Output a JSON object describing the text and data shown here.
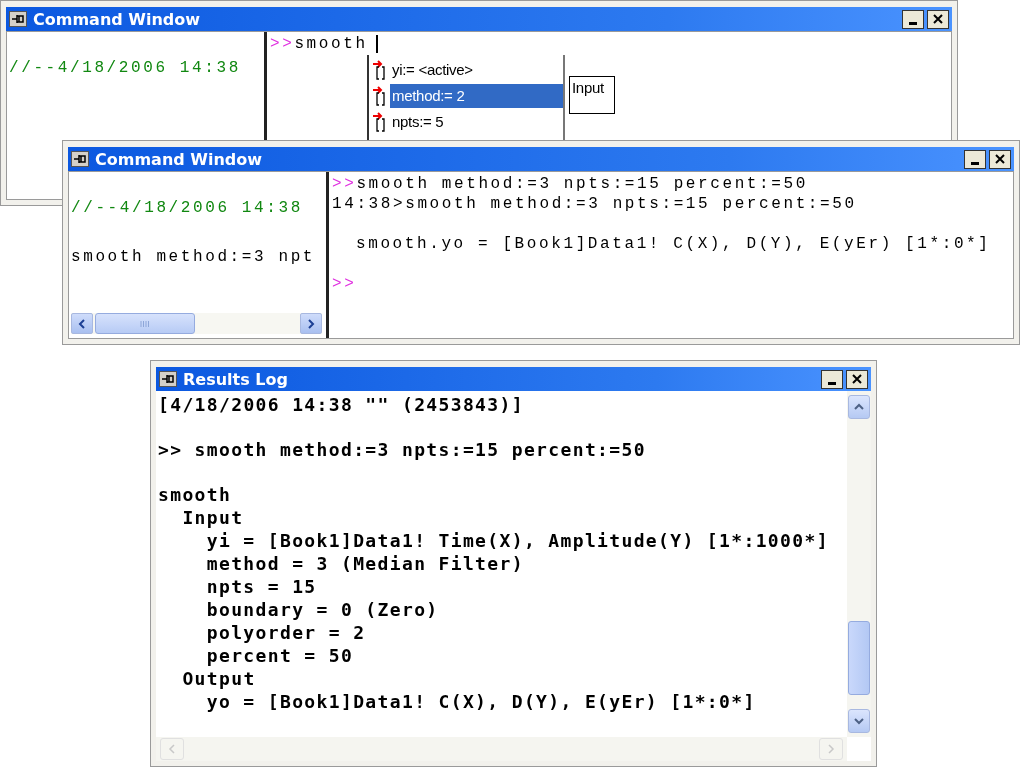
{
  "windows": [
    {
      "title": "Command Window",
      "history": [
        {
          "text": "//--4/18/2006 14:38",
          "kind": "timestamp"
        }
      ],
      "console": [
        {
          "prompt": ">>",
          "text": "smooth",
          "kind": "input",
          "cursor": true
        }
      ],
      "autocomplete": {
        "items": [
          {
            "label": "yi:= <active>",
            "selected": false
          },
          {
            "label": "method:= 2",
            "selected": true
          },
          {
            "label": "npts:= 5",
            "selected": false
          }
        ],
        "tooltip": "Input"
      }
    },
    {
      "title": "Command Window",
      "history": [
        {
          "text": "//--4/18/2006 14:38",
          "kind": "timestamp"
        },
        {
          "text": "smooth method:=3 npt",
          "kind": "command"
        }
      ],
      "console": [
        {
          "prompt": ">>",
          "text": "smooth method:=3 npts:=15 percent:=50",
          "kind": "input"
        },
        {
          "text": "14:38>smooth method:=3 npts:=15 percent:=50",
          "kind": "echo"
        },
        {
          "text": "smooth.yo = [Book1]Data1! C(X), D(Y), E(yEr) [1*:0*]",
          "kind": "output"
        },
        {
          "prompt": ">>",
          "kind": "input"
        }
      ]
    },
    {
      "title": "Results Log",
      "log": [
        {
          "text": "[4/18/2006 14:38 \"\" (2453843)]"
        },
        {
          "text": ">> smooth method:=3 npts:=15 percent:=50"
        },
        {
          "text": "smooth",
          "children": [
            {
              "text": "Input",
              "children": [
                {
                  "text": "yi = [Book1]Data1! Time(X), Amplitude(Y) [1*:1000*]"
                },
                {
                  "text": "method = 3 (Median Filter)"
                },
                {
                  "text": "npts = 15"
                },
                {
                  "text": "boundary = 0 (Zero)"
                },
                {
                  "text": "polyorder = 2"
                },
                {
                  "text": "percent = 50"
                }
              ]
            },
            {
              "text": "Output",
              "children": [
                {
                  "text": "yo = [Book1]Data1! C(X), D(Y), E(yEr) [1*:0*]"
                }
              ]
            }
          ]
        }
      ]
    }
  ]
}
